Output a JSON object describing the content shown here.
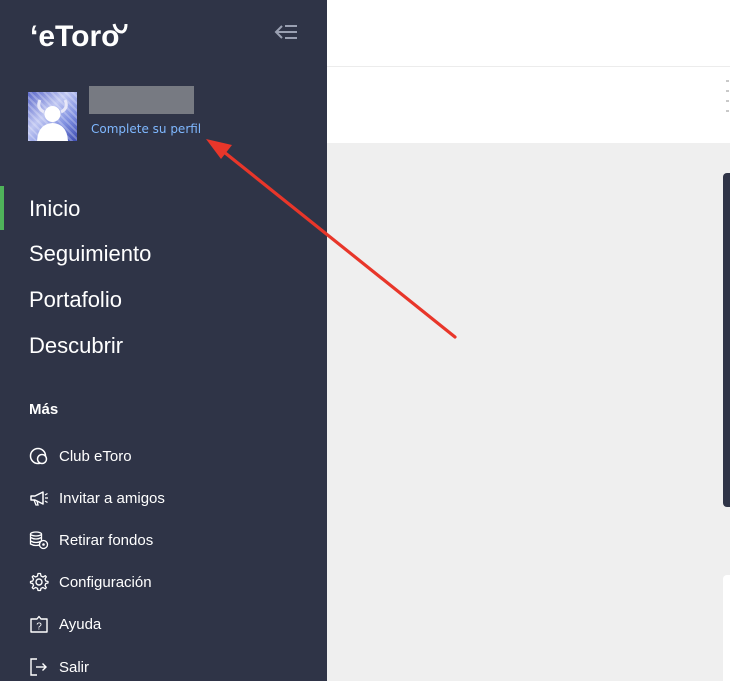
{
  "sidebar": {
    "brand": "eToro",
    "profile": {
      "complete_profile_link": "Complete su perfil"
    },
    "nav": [
      {
        "label": "Inicio",
        "active": true
      },
      {
        "label": "Seguimiento"
      },
      {
        "label": "Portafolio"
      },
      {
        "label": "Descubrir"
      }
    ],
    "more_title": "Más",
    "more_items": [
      {
        "label": "Club eToro",
        "icon": "club-icon"
      },
      {
        "label": "Invitar a amigos",
        "icon": "megaphone-icon"
      },
      {
        "label": "Retirar fondos",
        "icon": "coins-gear-icon"
      },
      {
        "label": "Configuración",
        "icon": "gear-icon"
      },
      {
        "label": "Ayuda",
        "icon": "help-icon"
      },
      {
        "label": "Salir",
        "icon": "logout-icon"
      }
    ]
  },
  "colors": {
    "sidebar_bg": "#2f3447",
    "active_indicator": "#4fb35a",
    "link": "#7fb8ff",
    "annotation_arrow": "#e8362a",
    "content_bg": "#efefef"
  }
}
